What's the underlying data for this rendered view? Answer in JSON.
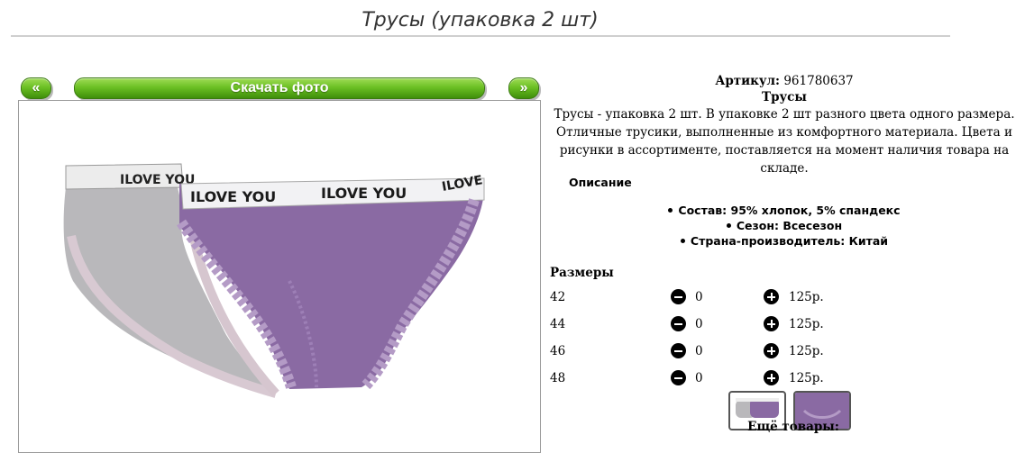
{
  "page": {
    "title": "Трусы (упаковка 2 шт)"
  },
  "gallery": {
    "prev_label": "«",
    "download_label": "Скачать фото",
    "next_label": "»",
    "waistband_text": "ILOVE YOU"
  },
  "product": {
    "article_label": "Артикул:",
    "article_value": "961780637",
    "name": "Трусы",
    "description": "Трусы - упаковка 2 шт. В упаковке 2 шт разного цвета одного размера. Отличные трусики, выполненные из комфортного материала. Цвета и рисунки в ассортименте, поставляется на момент наличия товара на складе.",
    "description_heading": "Описание",
    "properties": [
      {
        "label": "Состав:",
        "value": "95% хлопок, 5% спандекс"
      },
      {
        "label": "Сезон:",
        "value": "Всесезон"
      },
      {
        "label": "Страна-производитель:",
        "value": "Китай"
      }
    ]
  },
  "sizes": {
    "heading": "Размеры",
    "rows": [
      {
        "size": "42",
        "qty": "0",
        "price": "125р."
      },
      {
        "size": "44",
        "qty": "0",
        "price": "125р."
      },
      {
        "size": "46",
        "qty": "0",
        "price": "125р."
      },
      {
        "size": "48",
        "qty": "0",
        "price": "125р."
      }
    ]
  },
  "more_label": "Ещё товары:",
  "colors": {
    "button_green": "#6cc024",
    "gray_fabric": "#b9b8bb",
    "purple_fabric": "#8a6aa3"
  }
}
